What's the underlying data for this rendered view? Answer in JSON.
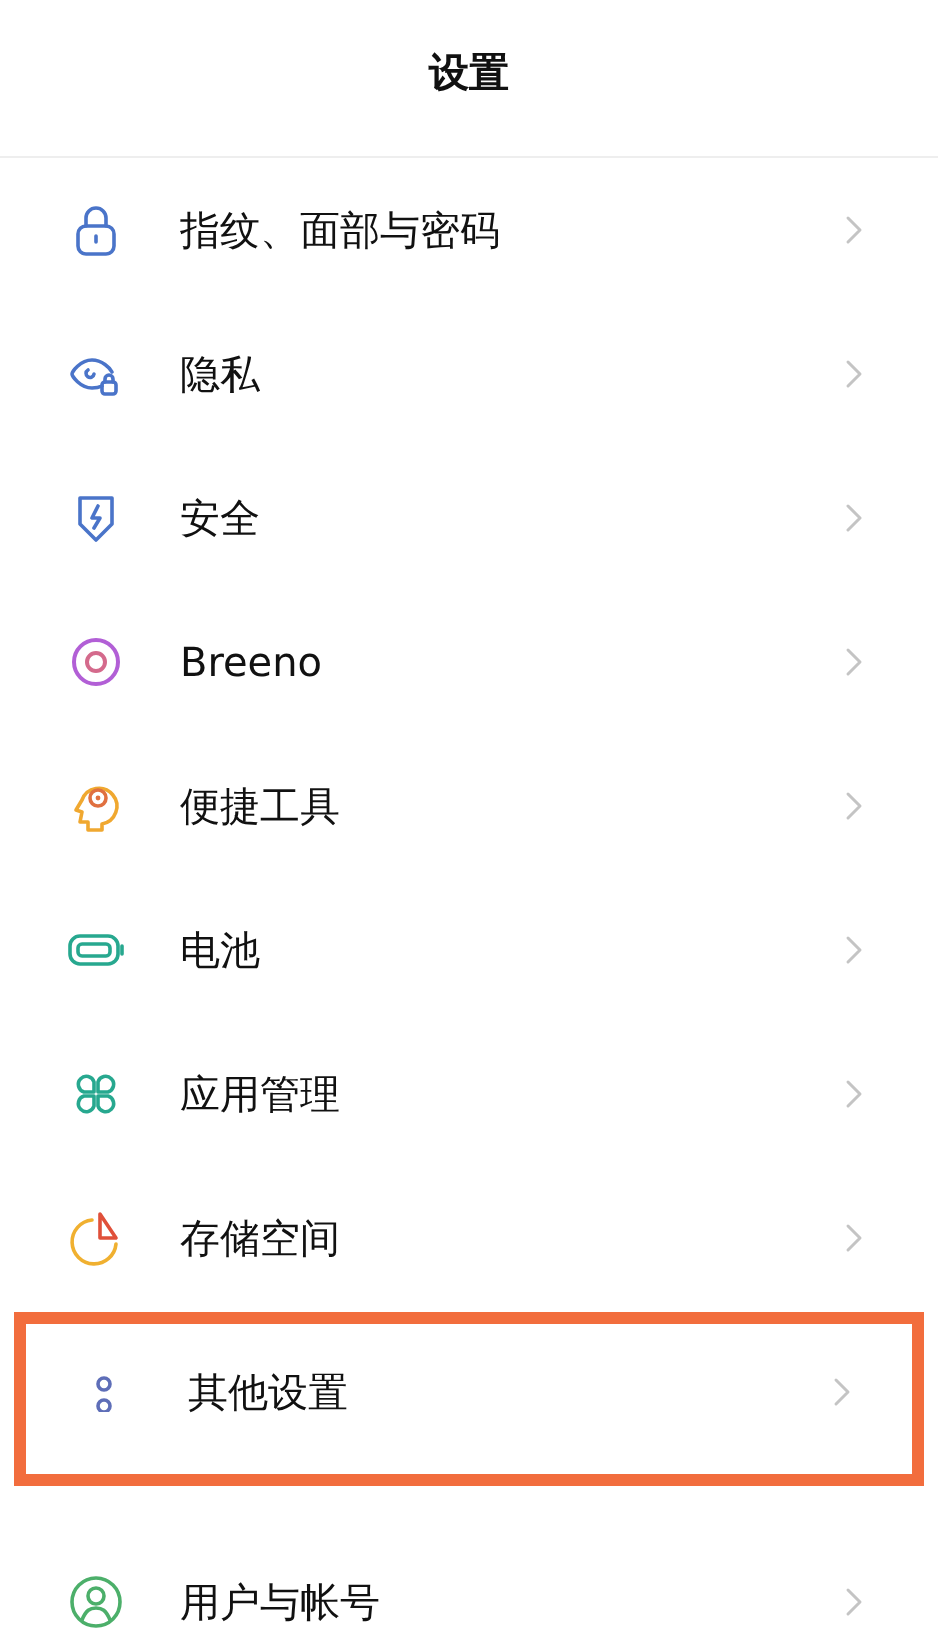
{
  "header": {
    "title": "设置"
  },
  "items": [
    {
      "label": "指纹、面部与密码",
      "highlighted": false
    },
    {
      "label": "隐私",
      "highlighted": false
    },
    {
      "label": "安全",
      "highlighted": false
    },
    {
      "label": "Breeno",
      "highlighted": false
    },
    {
      "label": "便捷工具",
      "highlighted": false
    },
    {
      "label": "电池",
      "highlighted": false
    },
    {
      "label": "应用管理",
      "highlighted": false
    },
    {
      "label": "存储空间",
      "highlighted": false
    },
    {
      "label": "其他设置",
      "highlighted": true
    },
    {
      "label": "用户与帐号",
      "highlighted": false
    }
  ]
}
